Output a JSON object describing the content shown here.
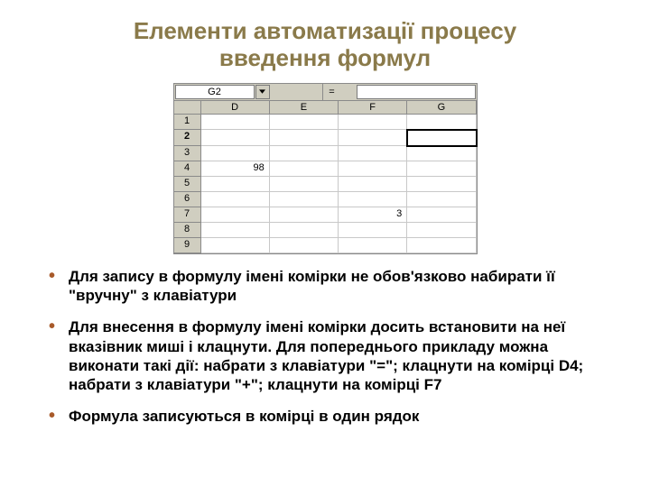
{
  "title_line1": "Елементи автоматизації процесу",
  "title_line2": "введення формул",
  "spreadsheet": {
    "namebox": "G2",
    "formula_eq": "=",
    "col_headers": [
      "D",
      "E",
      "F",
      "G"
    ],
    "row_headers": [
      "1",
      "2",
      "3",
      "4",
      "5",
      "6",
      "7",
      "8",
      "9"
    ],
    "bold_row": "2",
    "cells": {
      "D4": "98",
      "F7": "3"
    },
    "selected": "G2"
  },
  "bullets": [
    "Для запису в формулу імені комірки не обов'язково набирати її \"вручну\" з клавіатури",
    "Для внесення в формулу імені комірки досить встановити на неї вказівник миші і клацнути. Для попереднього прикладу можна виконати такі дії: набрати з клавіатури \"=\"; клацнути на комірці D4; набрати з клавіатури \"+\"; клацнути на комірці F7",
    "Формула записуються в комірці в один рядок"
  ]
}
